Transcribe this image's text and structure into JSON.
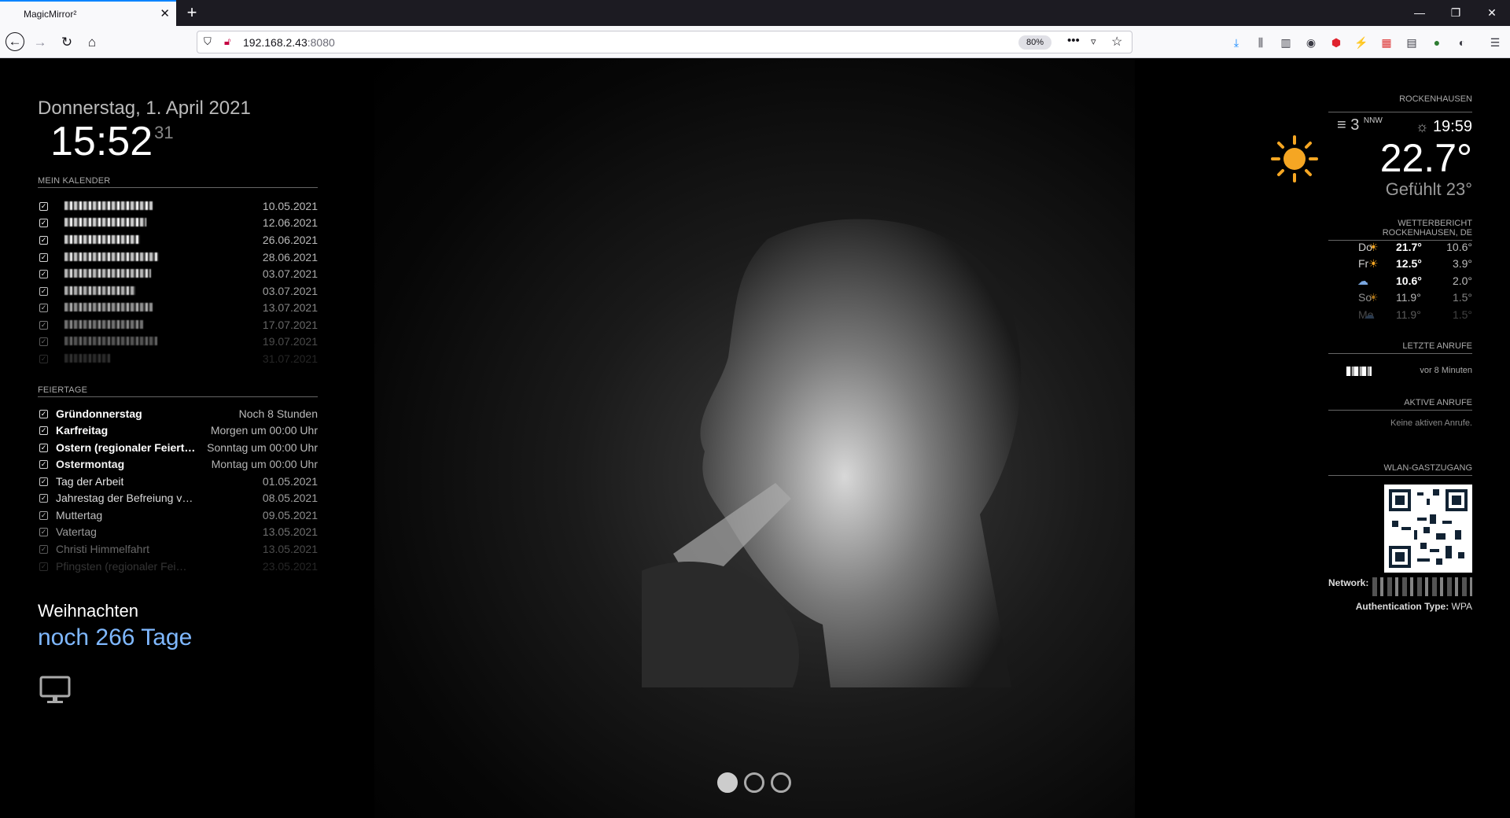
{
  "browser": {
    "tab_title": "MagicMirror²",
    "url_host": "192.168.2.43",
    "url_port": ":8080",
    "zoom": "80%"
  },
  "clock": {
    "date": "Donnerstag, 1. April 2021",
    "time": "15:52",
    "seconds": "31"
  },
  "calendar": {
    "header": "MEIN KALENDER",
    "dates": [
      "10.05.2021",
      "12.06.2021",
      "26.06.2021",
      "28.06.2021",
      "03.07.2021",
      "03.07.2021",
      "13.07.2021",
      "17.07.2021",
      "19.07.2021",
      "31.07.2021"
    ]
  },
  "holidays": {
    "header": "FEIERTAGE",
    "items": [
      {
        "name": "Gründonnerstag",
        "when": "Noch 8 Stunden"
      },
      {
        "name": "Karfreitag",
        "when": "Morgen um 00:00 Uhr"
      },
      {
        "name": "Ostern (regionaler Feiert…",
        "when": "Sonntag um 00:00 Uhr"
      },
      {
        "name": "Ostermontag",
        "when": "Montag um 00:00 Uhr"
      },
      {
        "name": "Tag der Arbeit",
        "when": "01.05.2021"
      },
      {
        "name": "Jahrestag der Befreiung v…",
        "when": "08.05.2021"
      },
      {
        "name": "Muttertag",
        "when": "09.05.2021"
      },
      {
        "name": "Vatertag",
        "when": "13.05.2021"
      },
      {
        "name": "Christi Himmelfahrt",
        "when": "13.05.2021"
      },
      {
        "name": "Pfingsten (regionaler Fei…",
        "when": "23.05.2021"
      }
    ]
  },
  "countdown": {
    "event": "Weihnachten",
    "remaining": "noch 266 Tage"
  },
  "weather": {
    "location": "ROCKENHAUSEN",
    "wind_speed": "3",
    "wind_dir": "NNW",
    "sunset": "19:59",
    "temperature": "22.7°",
    "feels_like": "Gefühlt 23°",
    "icon": "sun-icon"
  },
  "forecast": {
    "header": "WETTERBERICHT ROCKENHAUSEN, DE",
    "days": [
      {
        "day": "Do",
        "max": "21.7°",
        "min": "10.6°",
        "icon": "sun-icon"
      },
      {
        "day": "Fr",
        "max": "12.5°",
        "min": "3.9°",
        "icon": "sun-icon"
      },
      {
        "day": "Sa",
        "max": "10.6°",
        "min": "2.0°",
        "icon": "cloud-icon"
      },
      {
        "day": "So",
        "max": "11.9°",
        "min": "1.5°",
        "icon": "sun-icon"
      },
      {
        "day": "Mo",
        "max": "11.9°",
        "min": "1.5°",
        "icon": "cloud-icon"
      }
    ]
  },
  "calls": {
    "header": "LETZTE ANRUFE",
    "last_time": "vor 8 Minuten",
    "active_header": "AKTIVE ANRUFE",
    "active_none": "Keine aktiven Anrufe."
  },
  "wlan": {
    "header": "WLAN-GASTZUGANG",
    "network_label": "Network:",
    "auth_label": "Authentication Type:",
    "auth_value": "WPA"
  },
  "colors": {
    "countdown_accent": "#7fb8ff",
    "sun": "#f5a623"
  }
}
